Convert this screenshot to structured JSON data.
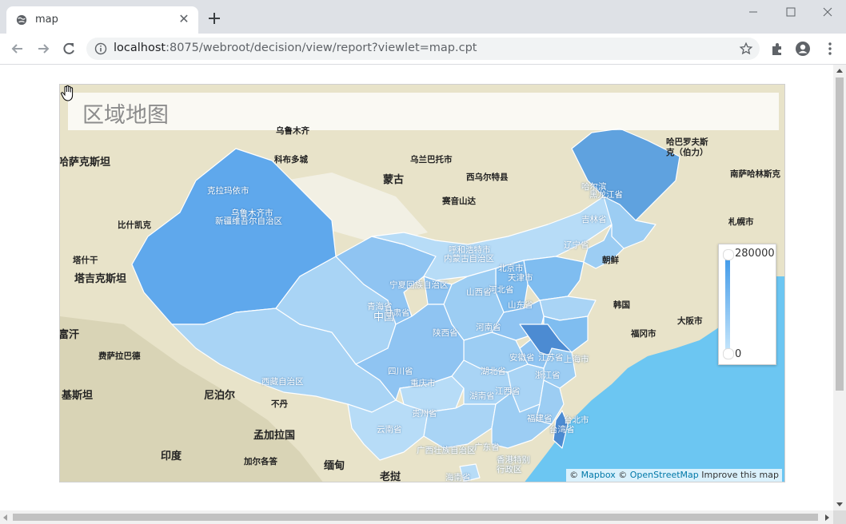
{
  "browser": {
    "tab_title": "map",
    "url_host": "localhost",
    "url_rest": ":8075/webroot/decision/view/report?viewlet=map.cpt",
    "icons": [
      "globe-icon",
      "close-icon",
      "plus-icon",
      "minimize-icon",
      "maximize-icon",
      "close-window-icon",
      "back-arrow-icon",
      "forward-arrow-icon",
      "reload-icon",
      "info-icon",
      "star-icon",
      "extensions-icon",
      "profile-icon",
      "menu-icon"
    ]
  },
  "map": {
    "title": "区域地图",
    "legend": {
      "max": "280000",
      "min": "0",
      "color_high": "#3c97e8",
      "color_low": "#c6e6fb"
    },
    "attribution": {
      "copy1": "©",
      "mapbox": "Mapbox",
      "copy2": "©",
      "osm": "OpenStreetMap",
      "improve": "Improve this map"
    },
    "base_labels": {
      "l1": "哈萨克斯坦",
      "l2": "乌鲁木齐",
      "l3": "科布多城",
      "l4": "乌兰巴托市",
      "l5": "蒙古",
      "l6": "西乌尔特县",
      "l7": "赛音山达",
      "l8": "哈巴罗夫斯克（伯力）",
      "l9": "南萨哈林斯克",
      "l10": "札幌市",
      "l11": "比什凯克",
      "l12": "塔什干",
      "l13": "塔吉克斯坦",
      "l14": "朝鲜",
      "l15": "韩国",
      "l16": "大阪市",
      "l17": "福冈市",
      "l18": "富汗",
      "l19": "费萨拉巴德",
      "l20": "基斯坦",
      "l21": "尼泊尔",
      "l22": "不丹",
      "l23": "孟加拉国",
      "l24": "印度",
      "l25": "加尔各答",
      "l26": "缅甸",
      "l27": "老挝",
      "l28": "中国",
      "l29": "台北市",
      "l30": "上海市"
    },
    "province_labels": {
      "xj": "新疆维吾尔自治区",
      "wlmq": "乌鲁木齐市",
      "klmy": "克拉玛依市",
      "xz": "西藏自治区",
      "qh": "青海省",
      "gs": "甘肃省",
      "nm": "内蒙古自治区",
      "hhht": "呼和浩特市",
      "nx": "宁夏回族自治区",
      "sx": "山西省",
      "hb": "河北省",
      "bj": "北京市",
      "tj": "天津市",
      "sd": "山东省",
      "hn": "河南省",
      "snx": "陕西省",
      "sc": "四川省",
      "cq": "重庆市",
      "gz": "贵州省",
      "yn": "云南省",
      "gx": "广西壮族自治区",
      "gd": "广东省",
      "hun": "湖南省",
      "hub": "湖北省",
      "ah": "安徽省",
      "js": "江苏省",
      "zj": "浙江省",
      "jx": "江西省",
      "fj": "福建省",
      "tw": "台湾省",
      "hln": "海南省",
      "hk": "香港特别行政区",
      "ln": "辽宁省",
      "jl": "吉林省",
      "hlj": "黑龙江省",
      "heb": "哈尔滨"
    }
  }
}
